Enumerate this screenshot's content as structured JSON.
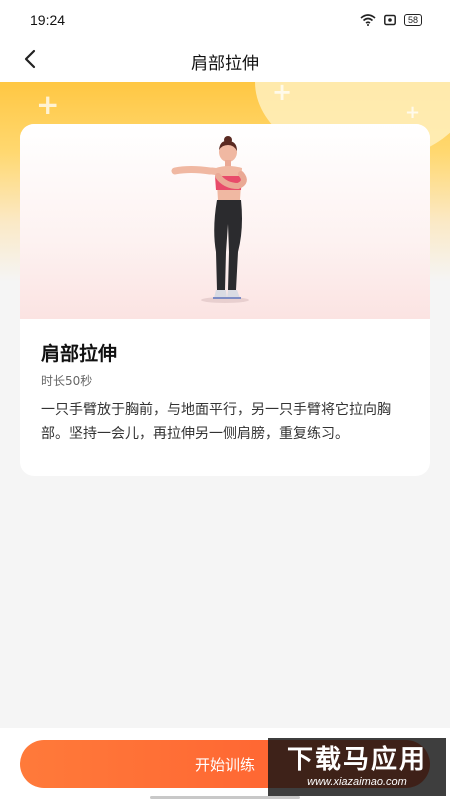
{
  "status_bar": {
    "time": "19:24",
    "battery": "58",
    "icons": [
      "wifi-icon",
      "notification-icon",
      "battery-icon"
    ]
  },
  "header": {
    "title": "肩部拉伸",
    "back_icon": "chevron-left-icon"
  },
  "exercise": {
    "title": "肩部拉伸",
    "duration": "时长50秒",
    "description": "一只手臂放于胸前，与地面平行，另一只手臂将它拉向胸部。坚持一会儿，再拉伸另一侧肩膀，重复练习。"
  },
  "actions": {
    "start_label": "开始训练"
  },
  "watermark": {
    "text": "下载马应用",
    "url": "www.xiazaimao.com"
  },
  "colors": {
    "accent_orange": "#ff6a33",
    "hero_yellow": "#ffc743",
    "top_pink": "#ef6b86"
  }
}
